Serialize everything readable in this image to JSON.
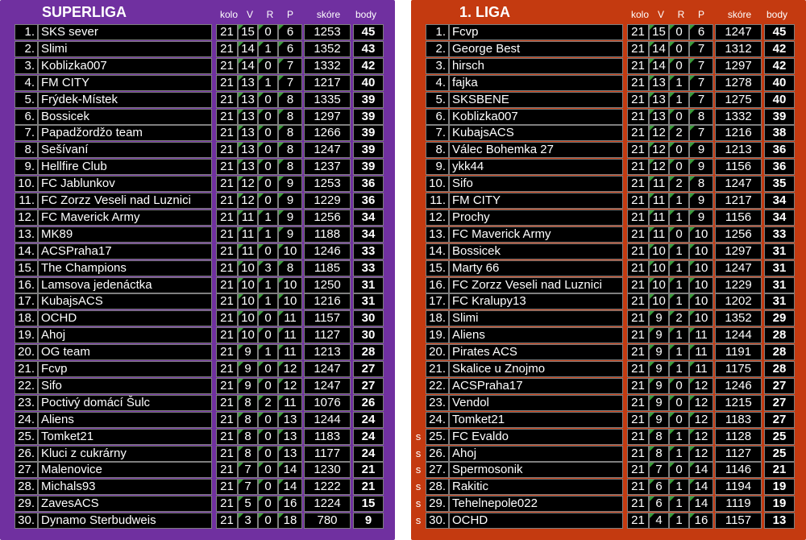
{
  "leagues": [
    {
      "title": "SUPERLIGA",
      "bg": "#7030a0",
      "headers": {
        "kolo": "kolo",
        "v": "V",
        "r": "R",
        "p": "P",
        "skore": "skóre",
        "body": "body"
      },
      "rows": [
        {
          "rank": "1.",
          "team": "SKS sever",
          "kolo": "21",
          "v": "15",
          "r": "0",
          "p": "6",
          "skore": "1253",
          "body": "45",
          "s": ""
        },
        {
          "rank": "2.",
          "team": "Slimi",
          "kolo": "21",
          "v": "14",
          "r": "1",
          "p": "6",
          "skore": "1352",
          "body": "43",
          "s": ""
        },
        {
          "rank": "3.",
          "team": "Koblizka007",
          "kolo": "21",
          "v": "14",
          "r": "0",
          "p": "7",
          "skore": "1332",
          "body": "42",
          "s": ""
        },
        {
          "rank": "4.",
          "team": "FM CITY",
          "kolo": "21",
          "v": "13",
          "r": "1",
          "p": "7",
          "skore": "1217",
          "body": "40",
          "s": ""
        },
        {
          "rank": "5.",
          "team": "Frýdek-Místek",
          "kolo": "21",
          "v": "13",
          "r": "0",
          "p": "8",
          "skore": "1335",
          "body": "39",
          "s": ""
        },
        {
          "rank": "6.",
          "team": "Bossicek",
          "kolo": "21",
          "v": "13",
          "r": "0",
          "p": "8",
          "skore": "1297",
          "body": "39",
          "s": ""
        },
        {
          "rank": "7.",
          "team": "Papadžordžo team",
          "kolo": "21",
          "v": "13",
          "r": "0",
          "p": "8",
          "skore": "1266",
          "body": "39",
          "s": ""
        },
        {
          "rank": "8.",
          "team": "Sešívaní",
          "kolo": "21",
          "v": "13",
          "r": "0",
          "p": "8",
          "skore": "1247",
          "body": "39",
          "s": ""
        },
        {
          "rank": "9.",
          "team": "Hellfire Club",
          "kolo": "21",
          "v": "13",
          "r": "0",
          "p": "8",
          "skore": "1237",
          "body": "39",
          "s": ""
        },
        {
          "rank": "10.",
          "team": "FC Jablunkov",
          "kolo": "21",
          "v": "12",
          "r": "0",
          "p": "9",
          "skore": "1253",
          "body": "36",
          "s": ""
        },
        {
          "rank": "11.",
          "team": "FC Zorzz Veseli nad Luznici",
          "kolo": "21",
          "v": "12",
          "r": "0",
          "p": "9",
          "skore": "1229",
          "body": "36",
          "s": ""
        },
        {
          "rank": "12.",
          "team": "FC Maverick Army",
          "kolo": "21",
          "v": "11",
          "r": "1",
          "p": "9",
          "skore": "1256",
          "body": "34",
          "s": ""
        },
        {
          "rank": "13.",
          "team": "MK89",
          "kolo": "21",
          "v": "11",
          "r": "1",
          "p": "9",
          "skore": "1188",
          "body": "34",
          "s": ""
        },
        {
          "rank": "14.",
          "team": "ACSPraha17",
          "kolo": "21",
          "v": "11",
          "r": "0",
          "p": "10",
          "skore": "1246",
          "body": "33",
          "s": ""
        },
        {
          "rank": "15.",
          "team": "The Champions",
          "kolo": "21",
          "v": "10",
          "r": "3",
          "p": "8",
          "skore": "1185",
          "body": "33",
          "s": ""
        },
        {
          "rank": "16.",
          "team": "Lamsova jedenáctka",
          "kolo": "21",
          "v": "10",
          "r": "1",
          "p": "10",
          "skore": "1250",
          "body": "31",
          "s": ""
        },
        {
          "rank": "17.",
          "team": "KubajsACS",
          "kolo": "21",
          "v": "10",
          "r": "1",
          "p": "10",
          "skore": "1216",
          "body": "31",
          "s": ""
        },
        {
          "rank": "18.",
          "team": "OCHD",
          "kolo": "21",
          "v": "10",
          "r": "0",
          "p": "11",
          "skore": "1157",
          "body": "30",
          "s": ""
        },
        {
          "rank": "19.",
          "team": "Ahoj",
          "kolo": "21",
          "v": "10",
          "r": "0",
          "p": "11",
          "skore": "1127",
          "body": "30",
          "s": ""
        },
        {
          "rank": "20.",
          "team": "OG team",
          "kolo": "21",
          "v": "9",
          "r": "1",
          "p": "11",
          "skore": "1213",
          "body": "28",
          "s": ""
        },
        {
          "rank": "21.",
          "team": "Fcvp",
          "kolo": "21",
          "v": "9",
          "r": "0",
          "p": "12",
          "skore": "1247",
          "body": "27",
          "s": ""
        },
        {
          "rank": "22.",
          "team": "Sifo",
          "kolo": "21",
          "v": "9",
          "r": "0",
          "p": "12",
          "skore": "1247",
          "body": "27",
          "s": ""
        },
        {
          "rank": "23.",
          "team": "Poctivý domácí Šulc",
          "kolo": "21",
          "v": "8",
          "r": "2",
          "p": "11",
          "skore": "1076",
          "body": "26",
          "s": ""
        },
        {
          "rank": "24.",
          "team": "Aliens",
          "kolo": "21",
          "v": "8",
          "r": "0",
          "p": "13",
          "skore": "1244",
          "body": "24",
          "s": ""
        },
        {
          "rank": "25.",
          "team": "Tomket21",
          "kolo": "21",
          "v": "8",
          "r": "0",
          "p": "13",
          "skore": "1183",
          "body": "24",
          "s": ""
        },
        {
          "rank": "26.",
          "team": "Kluci z cukrárny",
          "kolo": "21",
          "v": "8",
          "r": "0",
          "p": "13",
          "skore": "1177",
          "body": "24",
          "s": ""
        },
        {
          "rank": "27.",
          "team": "Malenovice",
          "kolo": "21",
          "v": "7",
          "r": "0",
          "p": "14",
          "skore": "1230",
          "body": "21",
          "s": ""
        },
        {
          "rank": "28.",
          "team": "Michals93",
          "kolo": "21",
          "v": "7",
          "r": "0",
          "p": "14",
          "skore": "1222",
          "body": "21",
          "s": ""
        },
        {
          "rank": "29.",
          "team": "ZavesACS",
          "kolo": "21",
          "v": "5",
          "r": "0",
          "p": "16",
          "skore": "1224",
          "body": "15",
          "s": ""
        },
        {
          "rank": "30.",
          "team": "Dynamo Sterbudweis",
          "kolo": "21",
          "v": "3",
          "r": "0",
          "p": "18",
          "skore": "780",
          "body": "9",
          "s": ""
        }
      ]
    },
    {
      "title": "1. LIGA",
      "bg": "#c43a10",
      "headers": {
        "kolo": "kolo",
        "v": "V",
        "r": "R",
        "p": "P",
        "skore": "skóre",
        "body": "body"
      },
      "rows": [
        {
          "rank": "1.",
          "team": "Fcvp",
          "kolo": "21",
          "v": "15",
          "r": "0",
          "p": "6",
          "skore": "1247",
          "body": "45",
          "s": ""
        },
        {
          "rank": "2.",
          "team": "George Best",
          "kolo": "21",
          "v": "14",
          "r": "0",
          "p": "7",
          "skore": "1312",
          "body": "42",
          "s": ""
        },
        {
          "rank": "3.",
          "team": "hirsch",
          "kolo": "21",
          "v": "14",
          "r": "0",
          "p": "7",
          "skore": "1297",
          "body": "42",
          "s": ""
        },
        {
          "rank": "4.",
          "team": "fajka",
          "kolo": "21",
          "v": "13",
          "r": "1",
          "p": "7",
          "skore": "1278",
          "body": "40",
          "s": ""
        },
        {
          "rank": "5.",
          "team": "SKSBENE",
          "kolo": "21",
          "v": "13",
          "r": "1",
          "p": "7",
          "skore": "1275",
          "body": "40",
          "s": ""
        },
        {
          "rank": "6.",
          "team": "Koblizka007",
          "kolo": "21",
          "v": "13",
          "r": "0",
          "p": "8",
          "skore": "1332",
          "body": "39",
          "s": ""
        },
        {
          "rank": "7.",
          "team": "KubajsACS",
          "kolo": "21",
          "v": "12",
          "r": "2",
          "p": "7",
          "skore": "1216",
          "body": "38",
          "s": ""
        },
        {
          "rank": "8.",
          "team": "Válec Bohemka 27",
          "kolo": "21",
          "v": "12",
          "r": "0",
          "p": "9",
          "skore": "1213",
          "body": "36",
          "s": ""
        },
        {
          "rank": "9.",
          "team": "ykk44",
          "kolo": "21",
          "v": "12",
          "r": "0",
          "p": "9",
          "skore": "1156",
          "body": "36",
          "s": ""
        },
        {
          "rank": "10.",
          "team": "Sifo",
          "kolo": "21",
          "v": "11",
          "r": "2",
          "p": "8",
          "skore": "1247",
          "body": "35",
          "s": ""
        },
        {
          "rank": "11.",
          "team": "FM CITY",
          "kolo": "21",
          "v": "11",
          "r": "1",
          "p": "9",
          "skore": "1217",
          "body": "34",
          "s": ""
        },
        {
          "rank": "12.",
          "team": "Prochy",
          "kolo": "21",
          "v": "11",
          "r": "1",
          "p": "9",
          "skore": "1156",
          "body": "34",
          "s": ""
        },
        {
          "rank": "13.",
          "team": "FC Maverick Army",
          "kolo": "21",
          "v": "11",
          "r": "0",
          "p": "10",
          "skore": "1256",
          "body": "33",
          "s": ""
        },
        {
          "rank": "14.",
          "team": "Bossicek",
          "kolo": "21",
          "v": "10",
          "r": "1",
          "p": "10",
          "skore": "1297",
          "body": "31",
          "s": ""
        },
        {
          "rank": "15.",
          "team": "Marty 66",
          "kolo": "21",
          "v": "10",
          "r": "1",
          "p": "10",
          "skore": "1247",
          "body": "31",
          "s": ""
        },
        {
          "rank": "16.",
          "team": "FC Zorzz Veseli nad Luznici",
          "kolo": "21",
          "v": "10",
          "r": "1",
          "p": "10",
          "skore": "1229",
          "body": "31",
          "s": ""
        },
        {
          "rank": "17.",
          "team": "FC Kralupy13",
          "kolo": "21",
          "v": "10",
          "r": "1",
          "p": "10",
          "skore": "1202",
          "body": "31",
          "s": ""
        },
        {
          "rank": "18.",
          "team": "Slimi",
          "kolo": "21",
          "v": "9",
          "r": "2",
          "p": "10",
          "skore": "1352",
          "body": "29",
          "s": ""
        },
        {
          "rank": "19.",
          "team": "Aliens",
          "kolo": "21",
          "v": "9",
          "r": "1",
          "p": "11",
          "skore": "1244",
          "body": "28",
          "s": ""
        },
        {
          "rank": "20.",
          "team": "Pirates ACS",
          "kolo": "21",
          "v": "9",
          "r": "1",
          "p": "11",
          "skore": "1191",
          "body": "28",
          "s": ""
        },
        {
          "rank": "21.",
          "team": "Skalice u Znojmo",
          "kolo": "21",
          "v": "9",
          "r": "1",
          "p": "11",
          "skore": "1175",
          "body": "28",
          "s": ""
        },
        {
          "rank": "22.",
          "team": "ACSPraha17",
          "kolo": "21",
          "v": "9",
          "r": "0",
          "p": "12",
          "skore": "1246",
          "body": "27",
          "s": ""
        },
        {
          "rank": "23.",
          "team": "Vendol",
          "kolo": "21",
          "v": "9",
          "r": "0",
          "p": "12",
          "skore": "1215",
          "body": "27",
          "s": ""
        },
        {
          "rank": "24.",
          "team": "Tomket21",
          "kolo": "21",
          "v": "9",
          "r": "0",
          "p": "12",
          "skore": "1183",
          "body": "27",
          "s": ""
        },
        {
          "rank": "25.",
          "team": "FC Evaldo",
          "kolo": "21",
          "v": "8",
          "r": "1",
          "p": "12",
          "skore": "1128",
          "body": "25",
          "s": "s"
        },
        {
          "rank": "26.",
          "team": "Ahoj",
          "kolo": "21",
          "v": "8",
          "r": "1",
          "p": "12",
          "skore": "1127",
          "body": "25",
          "s": "s"
        },
        {
          "rank": "27.",
          "team": "Spermosonik",
          "kolo": "21",
          "v": "7",
          "r": "0",
          "p": "14",
          "skore": "1146",
          "body": "21",
          "s": "s"
        },
        {
          "rank": "28.",
          "team": "Rakitic",
          "kolo": "21",
          "v": "6",
          "r": "1",
          "p": "14",
          "skore": "1194",
          "body": "19",
          "s": "s"
        },
        {
          "rank": "29.",
          "team": "Tehelnepole022",
          "kolo": "21",
          "v": "6",
          "r": "1",
          "p": "14",
          "skore": "1119",
          "body": "19",
          "s": "s"
        },
        {
          "rank": "30.",
          "team": "OCHD",
          "kolo": "21",
          "v": "4",
          "r": "1",
          "p": "16",
          "skore": "1157",
          "body": "13",
          "s": "s"
        }
      ]
    }
  ]
}
